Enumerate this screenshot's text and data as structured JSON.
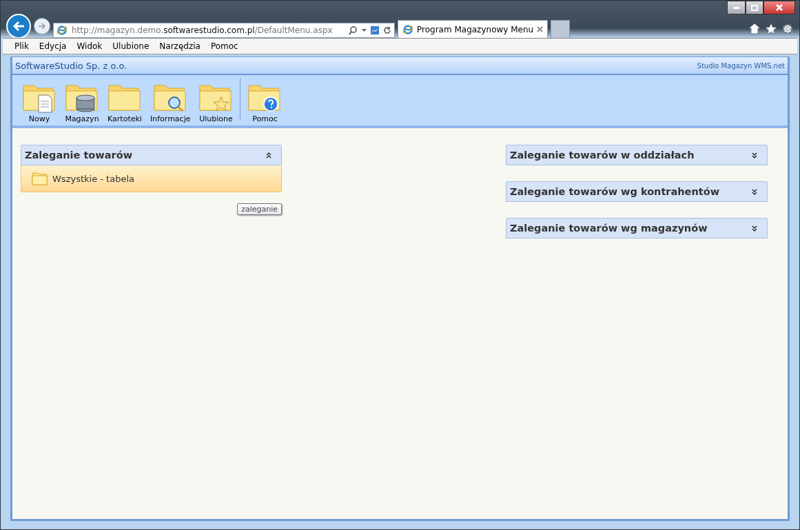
{
  "browser": {
    "url": "http://magazyn.demo.**softwarestudio.com.pl**/DefaultMenu.aspx",
    "tabs": [
      {
        "title": "Program Magazynowy Menu",
        "selected": true
      }
    ]
  },
  "menu_bar": [
    "Plik",
    "Edycja",
    "Widok",
    "Ulubione",
    "Narzędzia",
    "Pomoc"
  ],
  "app": {
    "company": "SoftwareStudio Sp. z o.o.",
    "product": "Studio Magazyn WMS.net"
  },
  "toolbar": [
    {
      "label": "Nowy",
      "kind": "document",
      "separator_before": false
    },
    {
      "label": "Magazyn",
      "kind": "database",
      "separator_before": false
    },
    {
      "label": "Kartoteki",
      "kind": "plain",
      "separator_before": false
    },
    {
      "label": "Informacje",
      "kind": "search",
      "separator_before": false
    },
    {
      "label": "Ulubione",
      "kind": "star",
      "separator_before": false
    },
    {
      "label": "Pomoc",
      "kind": "help",
      "separator_before": true
    }
  ],
  "panels_left": [
    {
      "title": "Zaleganie towarów",
      "expanded": true,
      "items": [
        "Wszystkie -  tabela"
      ]
    }
  ],
  "tooltip": "zaleganie",
  "panels_right": [
    {
      "title": "Zaleganie towarów w oddziałach",
      "expanded": false
    },
    {
      "title": "Zaleganie towarów wg kontrahentów",
      "expanded": false
    },
    {
      "title": "Zaleganie towarów wg magazynów",
      "expanded": false
    }
  ]
}
